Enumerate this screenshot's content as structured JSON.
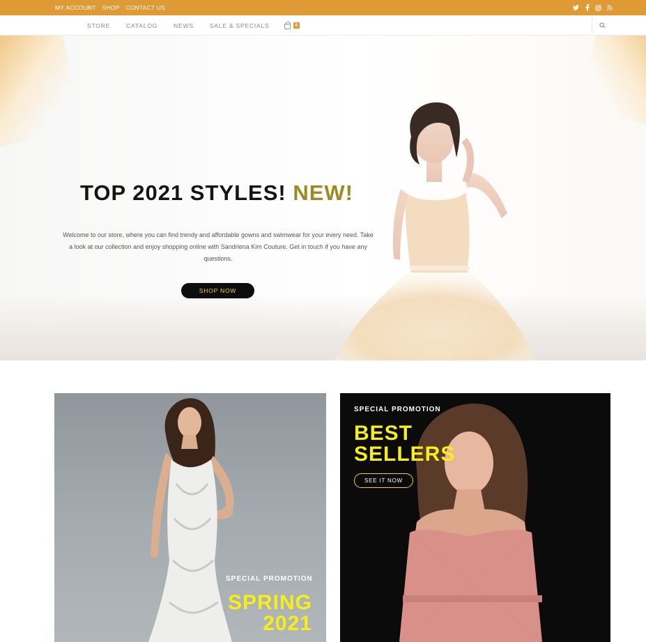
{
  "topbar": {
    "links": [
      "MY ACCOUNT",
      "SHOP",
      "CONTACT US"
    ],
    "social_icons": [
      "twitter-icon",
      "facebook-icon",
      "instagram-icon",
      "rss-icon"
    ]
  },
  "nav": {
    "items": [
      "STORE",
      "CATALOG",
      "NEWS",
      "SALE & SPECIALS"
    ],
    "cart_count": "0"
  },
  "hero": {
    "title_main": "TOP 2021 STYLES! ",
    "title_accent": "NEW!",
    "text": "Welcome to our store, where you can find trendy and affordable gowns and swimwear for your every need. Take a look at our collection and enjoy shopping online with Sandriena Kim Couture. Get in touch if you have any questions.",
    "button": "SHOP NOW"
  },
  "promos": {
    "left": {
      "label": "SPECIAL PROMOTION",
      "line1": "SPRING",
      "line2": "2021"
    },
    "right": {
      "label": "SPECIAL PROMOTION",
      "line1": "BEST",
      "line2": "SELLERS",
      "button": "SEE IT NOW"
    }
  },
  "colors": {
    "accent": "#e09a35",
    "title_accent": "#9c8a24",
    "promo_yellow": "#f7ee18"
  }
}
